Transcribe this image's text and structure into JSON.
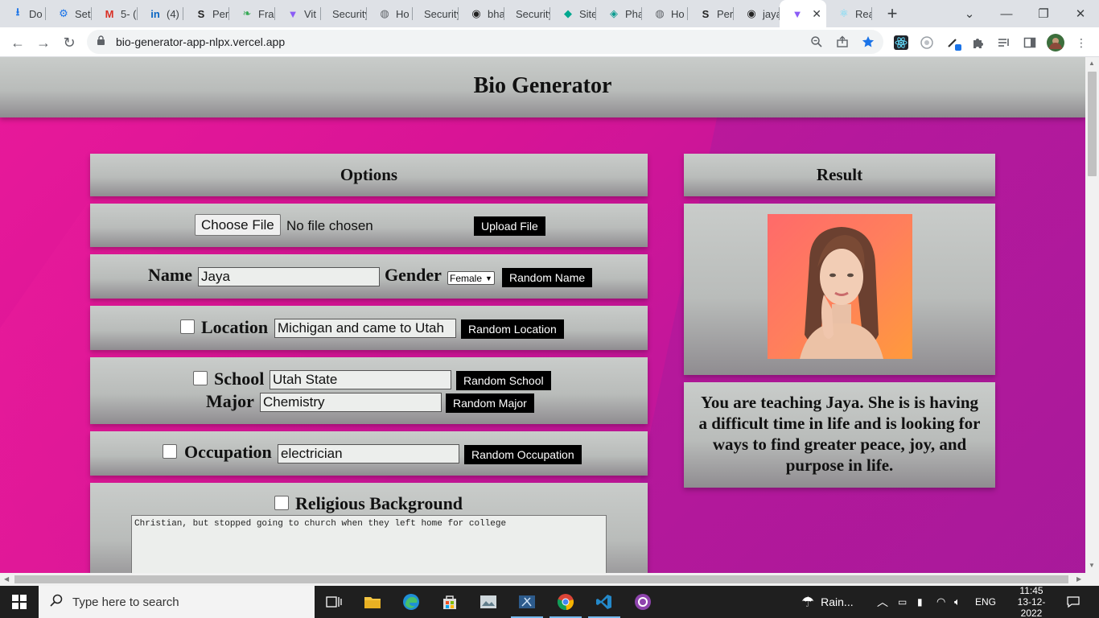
{
  "browser": {
    "tabs": [
      {
        "label": "Do",
        "icon": "download-icon",
        "color": "#1a73e8"
      },
      {
        "label": "Set",
        "icon": "gear-icon",
        "color": "#1a73e8"
      },
      {
        "label": "5- (",
        "icon": "gmail-icon",
        "color": "#d93025"
      },
      {
        "label": "(4)",
        "icon": "linkedin-icon",
        "color": "#0a66c2"
      },
      {
        "label": "Per",
        "icon": "s-logo-icon",
        "color": "#222222"
      },
      {
        "label": "Fra",
        "icon": "leaf-icon",
        "color": "#34a853"
      },
      {
        "label": "Vit",
        "icon": "vite-icon",
        "color": "#8b5cf6"
      },
      {
        "label": "Security",
        "icon": "none"
      },
      {
        "label": "Ho",
        "icon": "globe-icon",
        "color": "#5f6368"
      },
      {
        "label": "Security",
        "icon": "none"
      },
      {
        "label": "bha",
        "icon": "github-icon",
        "color": "#222222"
      },
      {
        "label": "Security",
        "icon": "none"
      },
      {
        "label": "Site",
        "icon": "diamond-icon",
        "color": "#00a88f"
      },
      {
        "label": "Pha",
        "icon": "teal-logo-icon",
        "color": "#0a9b8f"
      },
      {
        "label": "Ho",
        "icon": "globe-icon",
        "color": "#5f6368"
      },
      {
        "label": "Per",
        "icon": "s-logo-icon",
        "color": "#222222"
      },
      {
        "label": "jaya",
        "icon": "github-icon",
        "color": "#222222"
      },
      {
        "label": "",
        "icon": "vite-icon",
        "color": "#8b5cf6",
        "active": true
      },
      {
        "label": "Rea",
        "icon": "react-icon",
        "color": "#61dafb"
      }
    ],
    "new_tab": "+",
    "url": "bio-generator-app-nlpx.vercel.app"
  },
  "page": {
    "title": "Bio Generator",
    "options_title": "Options",
    "result_title": "Result",
    "file": {
      "choose_label": "Choose File",
      "status": "No file chosen",
      "upload_label": "Upload File"
    },
    "name": {
      "label": "Name",
      "value": "Jaya",
      "random_label": "Random Name"
    },
    "gender": {
      "label": "Gender",
      "selected": "Female"
    },
    "location": {
      "label": "Location",
      "value": "Michigan and came to Utah",
      "random_label": "Random Location",
      "checked": false
    },
    "school": {
      "label": "School",
      "value": "Utah State",
      "random_label": "Random School",
      "checked": false
    },
    "major": {
      "label": "Major",
      "value": "Chemistry",
      "random_label": "Random Major"
    },
    "occupation": {
      "label": "Occupation",
      "value": "electrician",
      "random_label": "Random Occupation",
      "checked": false
    },
    "religion": {
      "label": "Religious Background",
      "value": "Christian, but stopped going to church when they left home for college",
      "checked": false
    },
    "result_text": "You are teaching Jaya. She is is having a difficult time in life and is looking for ways to find greater peace, joy, and purpose in life."
  },
  "taskbar": {
    "search_placeholder": "Type here to search",
    "weather": "Rain...",
    "language": "ENG",
    "time": "11:45",
    "date": "13-12-2022"
  }
}
